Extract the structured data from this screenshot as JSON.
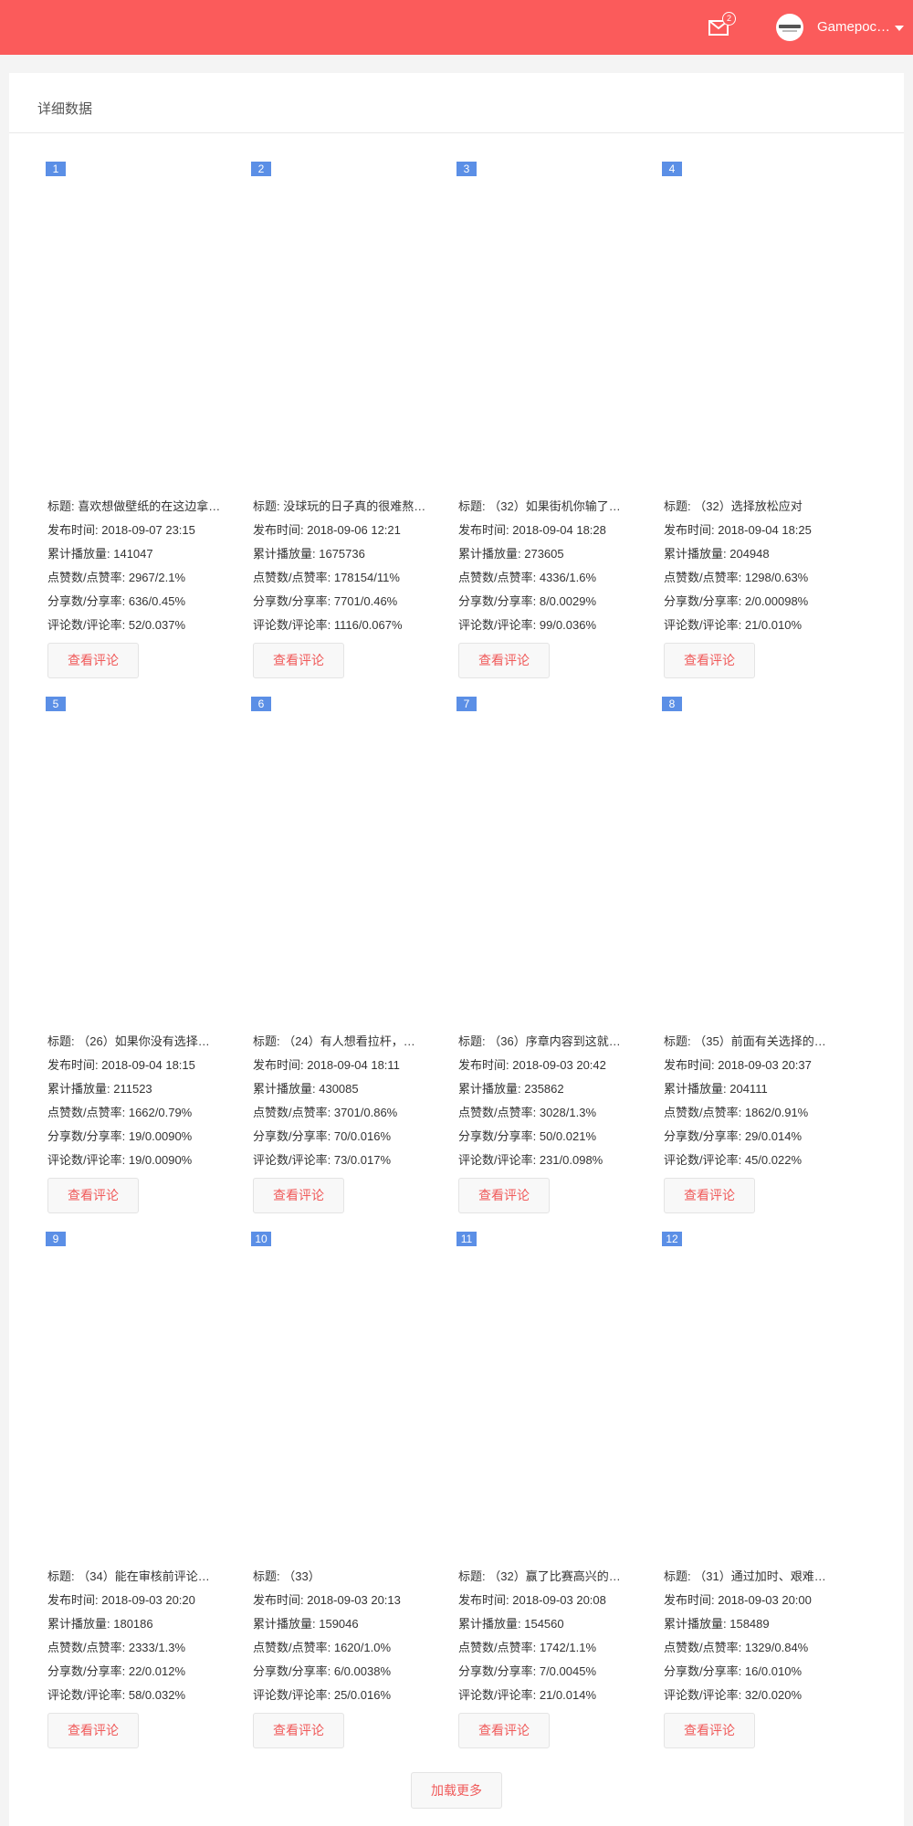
{
  "header": {
    "mail_badge": "2",
    "username": "Gamepoc…",
    "brand_color": "#fb5b5b"
  },
  "panel": {
    "title": "详细数据"
  },
  "labels": {
    "title": "标题: ",
    "publish_time": "发布时间: ",
    "plays": "累计播放量: ",
    "likes": "点赞数/点赞率: ",
    "shares": "分享数/分享率: ",
    "comments": "评论数/评论率: ",
    "view_comments": "查看评论",
    "load_more": "加载更多"
  },
  "videos": [
    {
      "idx": "1",
      "title": "喜欢想做壁纸的在这边拿…",
      "time": "2018-09-07 23:15",
      "plays": "141047",
      "likes": "2967/2.1%",
      "shares": "636/0.45%",
      "comments": "52/0.037%"
    },
    {
      "idx": "2",
      "title": "没球玩的日子真的很难熬…",
      "time": "2018-09-06 12:21",
      "plays": "1675736",
      "likes": "178154/11%",
      "shares": "7701/0.46%",
      "comments": "1116/0.067%"
    },
    {
      "idx": "3",
      "title": "（32）如果街机你输了…",
      "time": "2018-09-04 18:28",
      "plays": "273605",
      "likes": "4336/1.6%",
      "shares": "8/0.0029%",
      "comments": "99/0.036%"
    },
    {
      "idx": "4",
      "title": "（32）选择放松应对",
      "time": "2018-09-04 18:25",
      "plays": "204948",
      "likes": "1298/0.63%",
      "shares": "2/0.00098%",
      "comments": "21/0.010%"
    },
    {
      "idx": "5",
      "title": "（26）如果你没有选择…",
      "time": "2018-09-04 18:15",
      "plays": "211523",
      "likes": "1662/0.79%",
      "shares": "19/0.0090%",
      "comments": "19/0.0090%"
    },
    {
      "idx": "6",
      "title": "（24）有人想看拉杆，…",
      "time": "2018-09-04 18:11",
      "plays": "430085",
      "likes": "3701/0.86%",
      "shares": "70/0.016%",
      "comments": "73/0.017%"
    },
    {
      "idx": "7",
      "title": "（36）序章内容到这就…",
      "time": "2018-09-03 20:42",
      "plays": "235862",
      "likes": "3028/1.3%",
      "shares": "50/0.021%",
      "comments": "231/0.098%"
    },
    {
      "idx": "8",
      "title": "（35）前面有关选择的…",
      "time": "2018-09-03 20:37",
      "plays": "204111",
      "likes": "1862/0.91%",
      "shares": "29/0.014%",
      "comments": "45/0.022%"
    },
    {
      "idx": "9",
      "title": "（34）能在审核前评论…",
      "time": "2018-09-03 20:20",
      "plays": "180186",
      "likes": "2333/1.3%",
      "shares": "22/0.012%",
      "comments": "58/0.032%"
    },
    {
      "idx": "10",
      "title": "（33）",
      "time": "2018-09-03 20:13",
      "plays": "159046",
      "likes": "1620/1.0%",
      "shares": "6/0.0038%",
      "comments": "25/0.016%"
    },
    {
      "idx": "11",
      "title": "（32）赢了比赛高兴的…",
      "time": "2018-09-03 20:08",
      "plays": "154560",
      "likes": "1742/1.1%",
      "shares": "7/0.0045%",
      "comments": "21/0.014%"
    },
    {
      "idx": "12",
      "title": "（31）通过加时、艰难…",
      "time": "2018-09-03 20:00",
      "plays": "158489",
      "likes": "1329/0.84%",
      "shares": "16/0.010%",
      "comments": "32/0.020%"
    }
  ]
}
